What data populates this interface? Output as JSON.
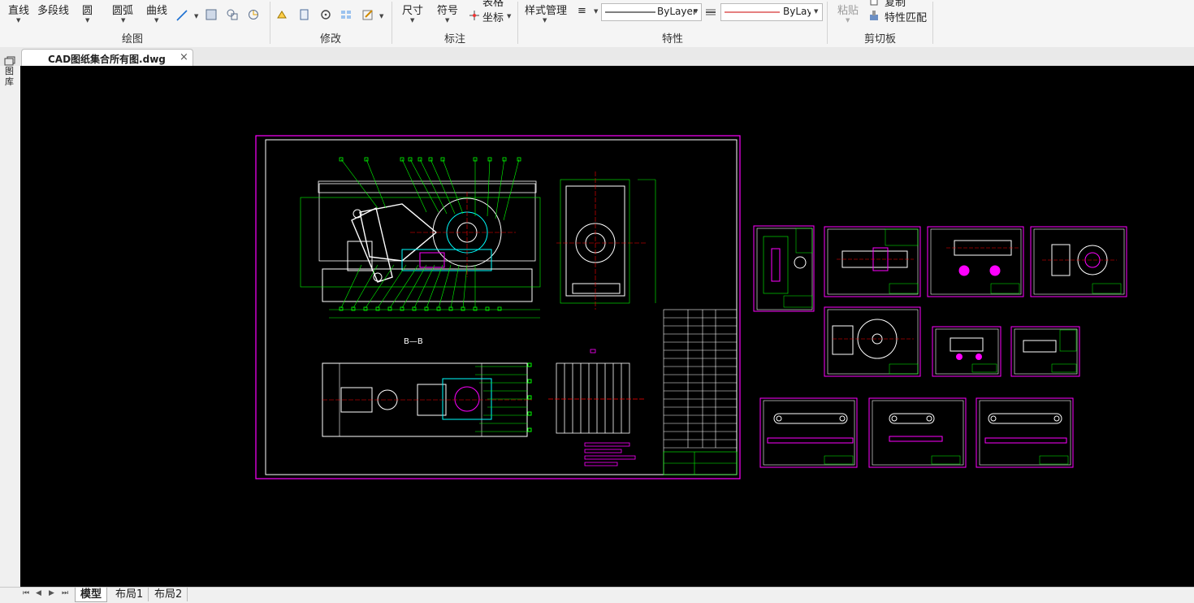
{
  "ribbon": {
    "draw": {
      "label": "绘图",
      "buttons": [
        "直线",
        "多段线",
        "圆",
        "圆弧",
        "曲线"
      ]
    },
    "modify": {
      "label": "修改"
    },
    "annotate": {
      "label": "标注",
      "dimension": "尺寸",
      "symbol": "符号",
      "table": "表格",
      "coordinate": "坐标"
    },
    "properties": {
      "label": "特性",
      "style_manager": "样式管理",
      "linetype": "ByLayer",
      "lineweight": "ByLayer",
      "linetype_color": "#000000",
      "lineweight_color": "#cc0000"
    },
    "clipboard": {
      "label": "剪切板",
      "paste": "粘贴",
      "copy": "复制",
      "match_properties": "特性匹配"
    }
  },
  "file_tab": {
    "name": "CAD图纸集合所有图.dwg",
    "close": "×"
  },
  "side_panel": {
    "label": "图库"
  },
  "layout_tabs": [
    "模型",
    "布局1",
    "布局2"
  ],
  "nav_arrows": [
    "⏮",
    "◀",
    "▶",
    "⏭"
  ],
  "drawing": {
    "section_label": "B—B",
    "colors": {
      "frame": "#ff00ff",
      "border": "#ffffff",
      "geometry": "#00ff00",
      "center": "#ff0000",
      "detail": "#00ffff",
      "accent": "#ffff00"
    }
  }
}
